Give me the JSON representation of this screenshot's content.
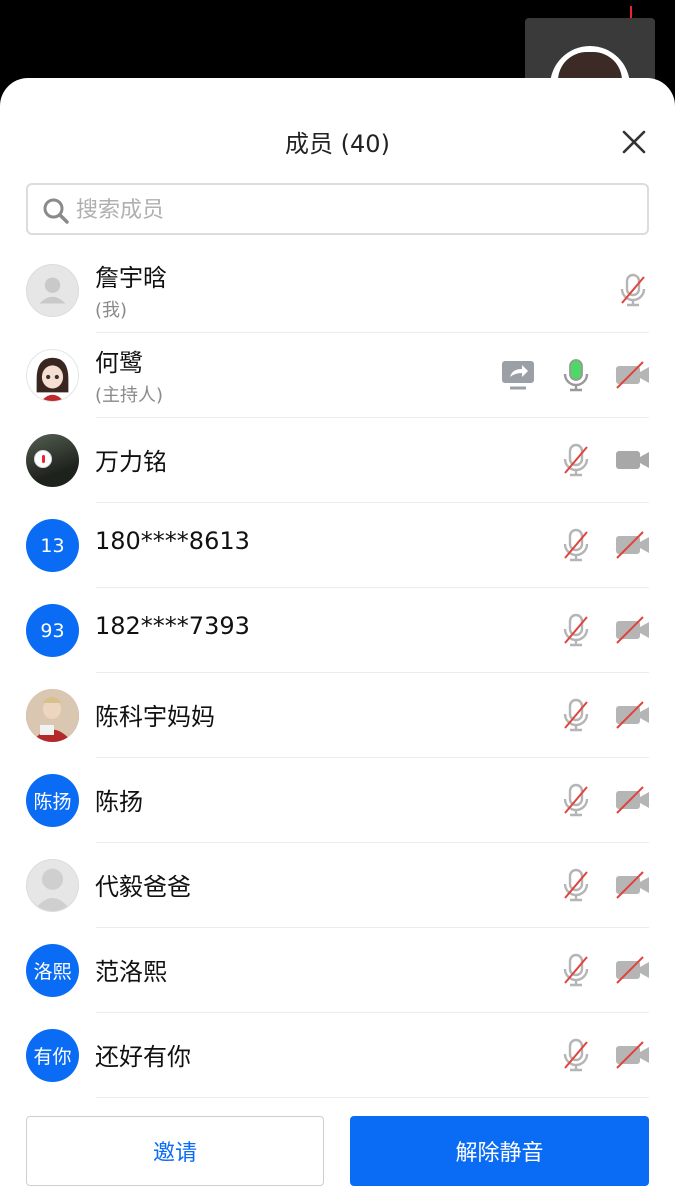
{
  "header": {
    "title": "成员 (40)"
  },
  "search": {
    "placeholder": "搜索成员",
    "value": ""
  },
  "members": [
    {
      "name": "詹宇晗",
      "sub": "(我)",
      "avatar": "gray-person",
      "mic": "muted",
      "camera": "none",
      "sharing": false
    },
    {
      "name": "何鹭",
      "sub": "(主持人)",
      "avatar": "photo",
      "mic": "active",
      "camera": "off",
      "sharing": true
    },
    {
      "name": "万力铭",
      "sub": "",
      "avatar": "photo",
      "mic": "muted",
      "camera": "on",
      "sharing": false
    },
    {
      "name": "180****8613",
      "sub": "",
      "avatar_text": "13",
      "mic": "muted",
      "camera": "off",
      "sharing": false
    },
    {
      "name": "182****7393",
      "sub": "",
      "avatar_text": "93",
      "mic": "muted",
      "camera": "off",
      "sharing": false
    },
    {
      "name": "陈科宇妈妈",
      "sub": "",
      "avatar": "photo",
      "mic": "muted",
      "camera": "off",
      "sharing": false
    },
    {
      "name": "陈扬",
      "sub": "",
      "avatar_text": "陈扬",
      "mic": "muted",
      "camera": "off",
      "sharing": false
    },
    {
      "name": "代毅爸爸",
      "sub": "",
      "avatar": "gray-person",
      "mic": "muted",
      "camera": "off",
      "sharing": false
    },
    {
      "name": "范洛熙",
      "sub": "",
      "avatar_text": "洛熙",
      "mic": "muted",
      "camera": "off",
      "sharing": false
    },
    {
      "name": "还好有你",
      "sub": "",
      "avatar_text": "有你",
      "mic": "muted",
      "camera": "off",
      "sharing": false
    }
  ],
  "footer": {
    "invite_label": "邀请",
    "unmute_label": "解除静音"
  },
  "icons": {
    "close": "close-icon",
    "search": "search-icon",
    "mic_muted": "mic-muted-icon",
    "mic_active": "mic-active-icon",
    "camera_off": "camera-off-icon",
    "camera_on": "camera-on-icon",
    "share": "screen-share-icon"
  },
  "colors": {
    "accent": "#0a6cf5",
    "mic_active": "#4cd964",
    "muted_slash": "#e0433c",
    "icon_gray": "#b5b5b5"
  }
}
